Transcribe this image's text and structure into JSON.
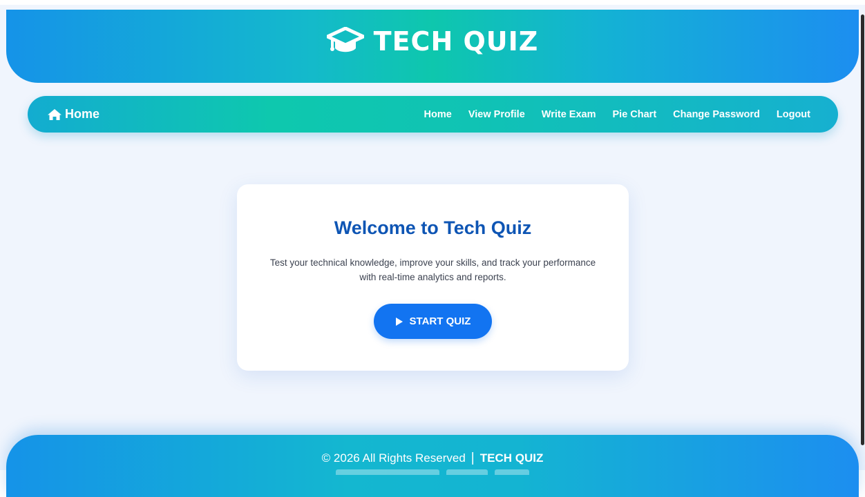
{
  "header": {
    "title": "TECH QUIZ",
    "icon": "graduation-cap-icon"
  },
  "navbar": {
    "brand_icon": "home-icon",
    "brand_label": "Home",
    "links": [
      {
        "label": "Home"
      },
      {
        "label": "View Profile"
      },
      {
        "label": "Write Exam"
      },
      {
        "label": "Pie Chart"
      },
      {
        "label": "Change Password"
      },
      {
        "label": "Logout"
      }
    ]
  },
  "welcome_card": {
    "title": "Welcome to Tech Quiz",
    "description": "Test your technical knowledge, improve your skills, and track your performance with real-time analytics and reports.",
    "button_label": "START QUIZ",
    "button_icon": "play-icon"
  },
  "footer": {
    "copyright": "© 2026 All Rights Reserved",
    "separator": "|",
    "brand": "TECH QUIZ"
  },
  "colors": {
    "primary": "#1274f1",
    "title_blue": "#0e55b4",
    "teal": "#0ec8ae",
    "page_bg": "#f0f5fd"
  }
}
